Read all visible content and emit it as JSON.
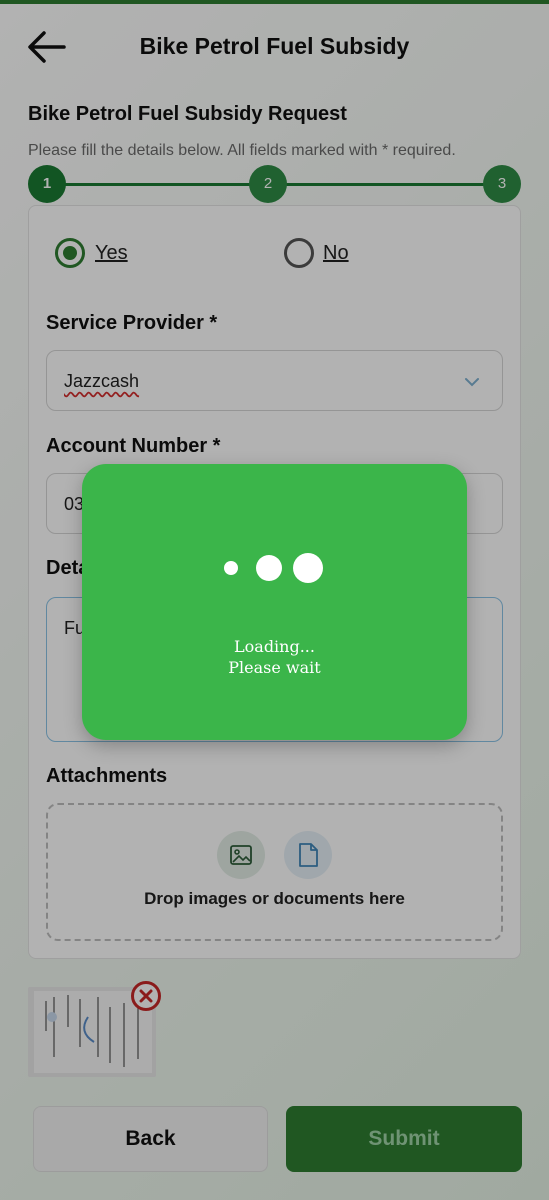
{
  "header": {
    "title": "Bike Petrol Fuel Subsidy",
    "back_icon": "arrow-left-icon"
  },
  "form": {
    "heading": "Bike Petrol Fuel Subsidy Request",
    "subtitle": "Please fill the details below. All fields marked with * required.",
    "steps": [
      "1",
      "2",
      "3"
    ],
    "current_step": 1,
    "radio": {
      "yes_label": "Yes",
      "no_label": "No",
      "selected": "Yes"
    },
    "service_provider": {
      "label": "Service Provider *",
      "value": "Jazzcash"
    },
    "account_number": {
      "label": "Account Number *",
      "value_visible": "03"
    },
    "details": {
      "label_visible": "Deta",
      "value_visible": "Fu"
    },
    "attachments": {
      "label": "Attachments",
      "drop_text": "Drop images or documents here",
      "icons": [
        "image-icon",
        "document-icon"
      ]
    }
  },
  "buttons": {
    "back": "Back",
    "submit": "Submit"
  },
  "loading": {
    "line1": "Loading...",
    "line2": "Please wait"
  },
  "colors": {
    "primary": "#2e7d32",
    "loading_bg": "#3bb54a",
    "error": "#c62828"
  }
}
